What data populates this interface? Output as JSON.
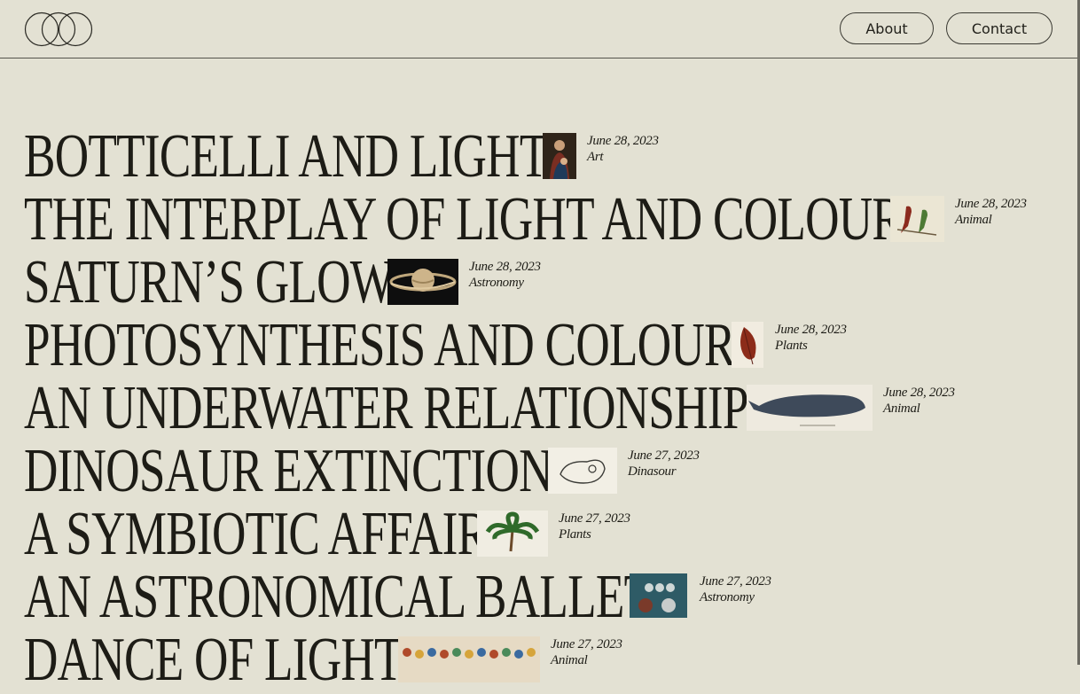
{
  "header": {
    "about_label": "About",
    "contact_label": "Contact"
  },
  "articles": [
    {
      "title": "BOTTICELLI AND LIGHT",
      "date": "June 28, 2023",
      "category": "Art",
      "thumb": "madonna-painting"
    },
    {
      "title": "THE INTERPLAY OF LIGHT AND COLOUR",
      "date": "June 28, 2023",
      "category": "Animal",
      "thumb": "parrots-illustration"
    },
    {
      "title": "SATURN’S GLOW",
      "date": "June 28, 2023",
      "category": "Astronomy",
      "thumb": "saturn-image"
    },
    {
      "title": "PHOTOSYNTHESIS AND COLOUR",
      "date": "June 28, 2023",
      "category": "Plants",
      "thumb": "leaf-illustration"
    },
    {
      "title": "AN UNDERWATER RELATIONSHIP",
      "date": "June 28, 2023",
      "category": "Animal",
      "thumb": "whale-illustration"
    },
    {
      "title": "DINOSAUR EXTINCTION",
      "date": "June 27, 2023",
      "category": "Dinasour",
      "thumb": "skull-illustration"
    },
    {
      "title": "A SYMBIOTIC AFFAIR",
      "date": "June 27, 2023",
      "category": "Plants",
      "thumb": "palm-illustration"
    },
    {
      "title": "AN ASTRONOMICAL BALLET",
      "date": "June 27, 2023",
      "category": "Astronomy",
      "thumb": "planets-chart"
    },
    {
      "title": "DANCE OF LIGHT",
      "date": "June 27, 2023",
      "category": "Animal",
      "thumb": "birds-illustration"
    }
  ]
}
